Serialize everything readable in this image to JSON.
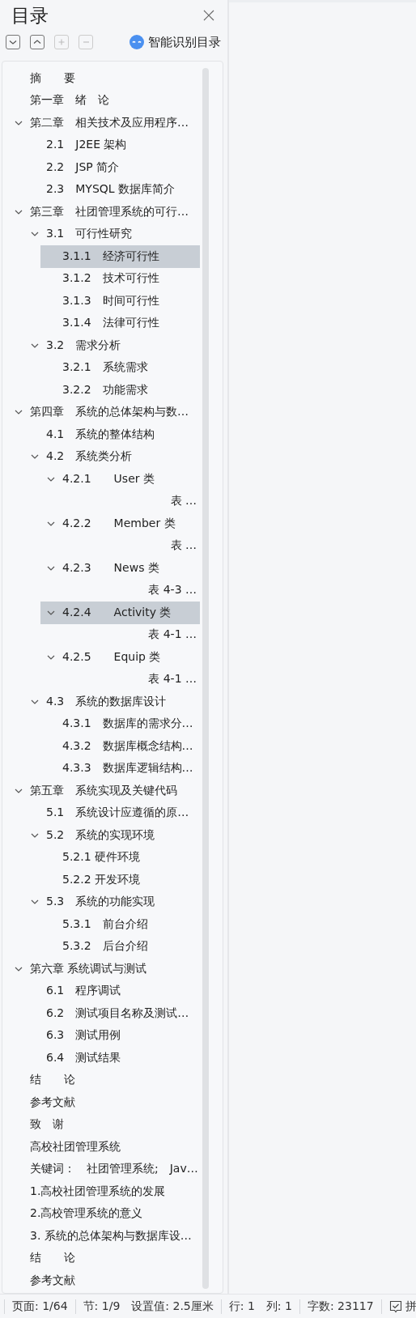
{
  "panel": {
    "title": "目录",
    "smart_button": "智能识别目录",
    "toolbar": [
      {
        "kind": "expand",
        "disabled": false
      },
      {
        "kind": "collapse",
        "disabled": false
      },
      {
        "kind": "plus",
        "disabled": true
      },
      {
        "kind": "minus",
        "disabled": true
      }
    ]
  },
  "tree": [
    {
      "label": "摘　　要",
      "selected": false
    },
    {
      "label": "第一章　绪　论",
      "selected": false
    },
    {
      "label": "第二章　相关技术及应用程序…",
      "selected": false,
      "expanded": true,
      "children": [
        {
          "label": "2.1　J2EE 架构",
          "selected": false
        },
        {
          "label": "2.2　JSP 简介",
          "selected": false
        },
        {
          "label": "2.3　MYSQL 数据库简介",
          "selected": false
        }
      ]
    },
    {
      "label": "第三章　社团管理系统的可行…",
      "selected": false,
      "expanded": true,
      "children": [
        {
          "label": "3.1　可行性研究",
          "selected": false,
          "expanded": true,
          "children": [
            {
              "label": "3.1.1　经济可行性",
              "selected": true
            },
            {
              "label": "3.1.2　技术可行性",
              "selected": false
            },
            {
              "label": "3.1.3　时间可行性",
              "selected": false
            },
            {
              "label": "3.1.4　法律可行性",
              "selected": false
            }
          ]
        },
        {
          "label": "3.2　需求分析",
          "selected": false,
          "expanded": true,
          "children": [
            {
              "label": "3.2.1　系统需求",
              "selected": false
            },
            {
              "label": "3.2.2　功能需求",
              "selected": false
            }
          ]
        }
      ]
    },
    {
      "label": "第四章　系统的总体架构与数…",
      "selected": false,
      "expanded": true,
      "children": [
        {
          "label": "4.1　系统的整体结构",
          "selected": false
        },
        {
          "label": "4.2　系统类分析",
          "selected": false,
          "expanded": true,
          "children": [
            {
              "label": "4.2.1　　User 类",
              "selected": false,
              "expanded": true,
              "children": [
                {
                  "label": "表 …",
                  "kind": "caption",
                  "selected": false
                }
              ]
            },
            {
              "label": "4.2.2　　Member 类",
              "selected": false,
              "expanded": true,
              "children": [
                {
                  "label": "表 …",
                  "kind": "caption",
                  "selected": false
                }
              ]
            },
            {
              "label": "4.2.3　　News 类",
              "selected": false,
              "expanded": true,
              "children": [
                {
                  "label": "表 4-3 …",
                  "kind": "caption",
                  "selected": false
                }
              ]
            },
            {
              "label": "4.2.4　　Activity 类",
              "selected": true,
              "expanded": true,
              "children": [
                {
                  "label": "表 4-1 …",
                  "kind": "caption",
                  "selected": false
                }
              ]
            },
            {
              "label": "4.2.5　　Equip 类",
              "selected": false,
              "expanded": true,
              "children": [
                {
                  "label": "表 4-1 …",
                  "kind": "caption",
                  "selected": false
                }
              ]
            }
          ]
        },
        {
          "label": "4.3　系统的数据库设计",
          "selected": false,
          "expanded": true,
          "children": [
            {
              "label": "4.3.1　数据库的需求分…",
              "selected": false
            },
            {
              "label": "4.3.2　数据库概念结构…",
              "selected": false
            },
            {
              "label": "4.3.3　数据库逻辑结构…",
              "selected": false
            }
          ]
        }
      ]
    },
    {
      "label": "第五章　系统实现及关键代码",
      "selected": false,
      "expanded": true,
      "children": [
        {
          "label": "5.1　系统设计应遵循的原…",
          "selected": false
        },
        {
          "label": "5.2　系统的实现环境",
          "selected": false,
          "expanded": true,
          "children": [
            {
              "label": "5.2.1 硬件环境",
              "selected": false
            },
            {
              "label": "5.2.2 开发环境",
              "selected": false
            }
          ]
        },
        {
          "label": "5.3　系统的功能实现",
          "selected": false,
          "expanded": true,
          "children": [
            {
              "label": "5.3.1　前台介绍",
              "selected": false
            },
            {
              "label": "5.3.2　后台介绍",
              "selected": false
            }
          ]
        }
      ]
    },
    {
      "label": "第六章 系统调试与测试",
      "selected": false,
      "expanded": true,
      "children": [
        {
          "label": "6.1　程序调试",
          "selected": false
        },
        {
          "label": "6.2　测试项目名称及测试…",
          "selected": false
        },
        {
          "label": "6.3　测试用例",
          "selected": false
        },
        {
          "label": "6.4　测试结果",
          "selected": false
        }
      ]
    },
    {
      "label": "结　　论",
      "selected": false
    },
    {
      "label": "参考文献",
      "selected": false
    },
    {
      "label": "致　谢",
      "selected": false
    },
    {
      "label": "高校社团管理系统",
      "selected": false
    },
    {
      "label": "关键词：　社团管理系统;　Jav…",
      "selected": false
    },
    {
      "label": "1.高校社团管理系统的发展",
      "selected": false
    },
    {
      "label": "2.高校管理系统的意义",
      "selected": false
    },
    {
      "label": "3. 系统的总体架构与数据库设…",
      "selected": false
    },
    {
      "label": "结　　论",
      "selected": false
    },
    {
      "label": "参考文献",
      "selected": false
    }
  ],
  "status_bar": [
    {
      "items": [
        {
          "text": "页面: 1/64"
        }
      ]
    },
    {
      "items": [
        {
          "text": "节: 1/9"
        },
        {
          "text": "设置值: 2.5厘米"
        }
      ]
    },
    {
      "items": [
        {
          "text": "行: 1"
        },
        {
          "text": "列: 1"
        }
      ]
    },
    {
      "items": [
        {
          "text": "字数: 23117"
        }
      ]
    },
    {
      "items": [
        {
          "text": "拼",
          "kind": "check"
        }
      ]
    }
  ]
}
